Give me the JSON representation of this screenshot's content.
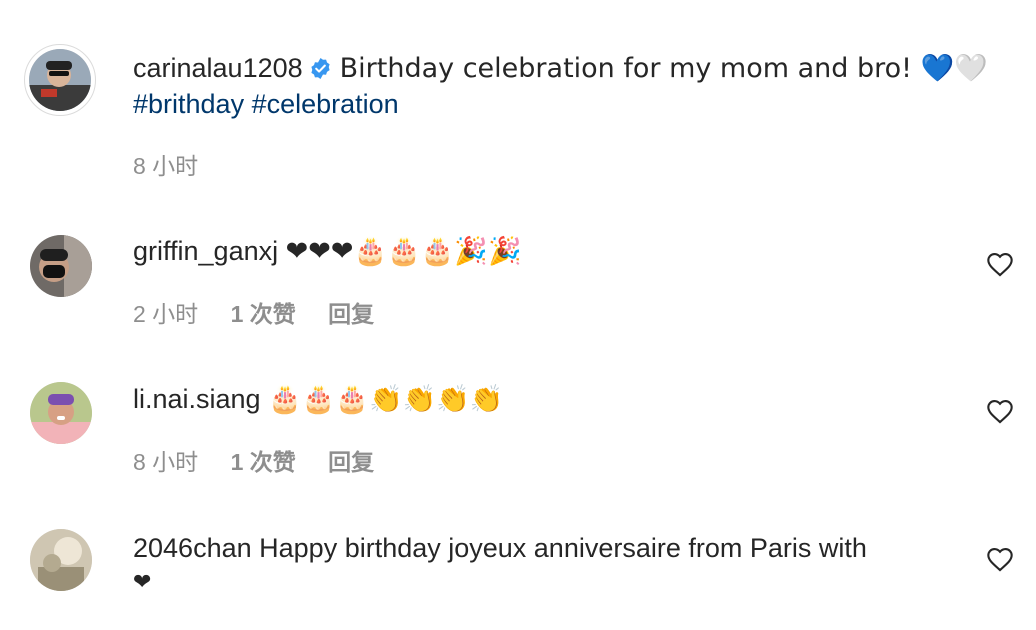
{
  "post": {
    "username": "carinalau1208",
    "caption": "Birthday celebration for my mom and bro! 💙🤍",
    "hashtags": "#brithday #celebration",
    "time": "8 小时"
  },
  "comments": [
    {
      "username": "griffin_ganxj",
      "text": "❤❤❤🎂🎂🎂🎉🎉",
      "time": "2 小时",
      "likes": "1 次赞",
      "reply": "回复"
    },
    {
      "username": "li.nai.siang",
      "text": "🎂🎂🎂👏👏👏👏",
      "time": "8 小时",
      "likes": "1 次赞",
      "reply": "回复"
    },
    {
      "username": "2046chan",
      "text_line1": "Happy birthday joyeux anniversaire from Paris with",
      "text_line2": "❤"
    }
  ],
  "icons": {
    "verified": "verified-badge-icon",
    "like": "heart-outline-icon"
  },
  "colors": {
    "text": "#262626",
    "secondary": "#8e8e8e",
    "hashtag": "#00376b",
    "verified": "#3897f0"
  }
}
